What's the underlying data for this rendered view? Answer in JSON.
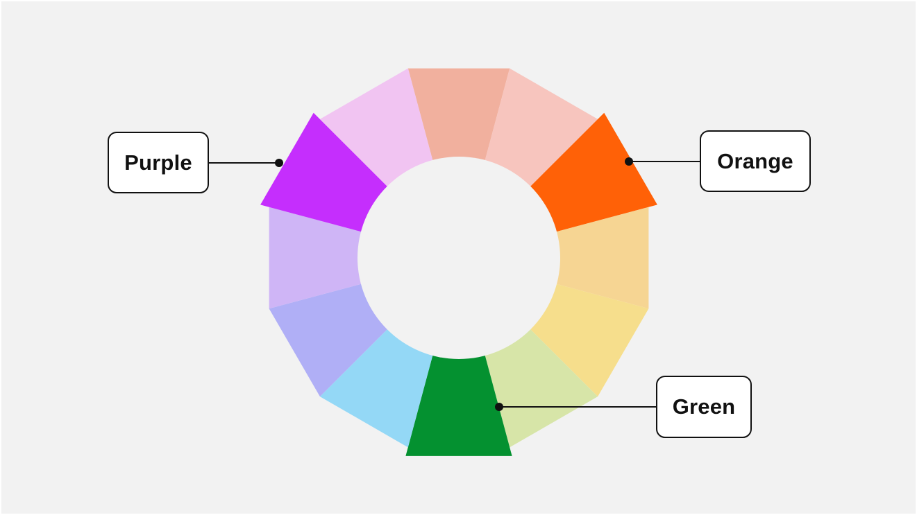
{
  "diagram": {
    "segments": [
      {
        "id": "seg-top",
        "color": "#f1b09e",
        "highlighted": false
      },
      {
        "id": "seg-top-right",
        "color": "#f7c5be",
        "highlighted": false
      },
      {
        "id": "seg-orange",
        "color": "#ff6107",
        "highlighted": true
      },
      {
        "id": "seg-right",
        "color": "#f6d593",
        "highlighted": false
      },
      {
        "id": "seg-lower-right",
        "color": "#f6de8c",
        "highlighted": false
      },
      {
        "id": "seg-yellow-green",
        "color": "#d7e5a8",
        "highlighted": false
      },
      {
        "id": "seg-green",
        "color": "#049130",
        "highlighted": true
      },
      {
        "id": "seg-light-blue",
        "color": "#94d8f6",
        "highlighted": false
      },
      {
        "id": "seg-periwinkle",
        "color": "#b0aff6",
        "highlighted": false
      },
      {
        "id": "seg-lavender",
        "color": "#cfb5f6",
        "highlighted": false
      },
      {
        "id": "seg-purple",
        "color": "#c52efd",
        "highlighted": true
      },
      {
        "id": "seg-pink",
        "color": "#f1c4f2",
        "highlighted": false
      }
    ],
    "labels": {
      "purple": "Purple",
      "orange": "Orange",
      "green": "Green"
    }
  }
}
